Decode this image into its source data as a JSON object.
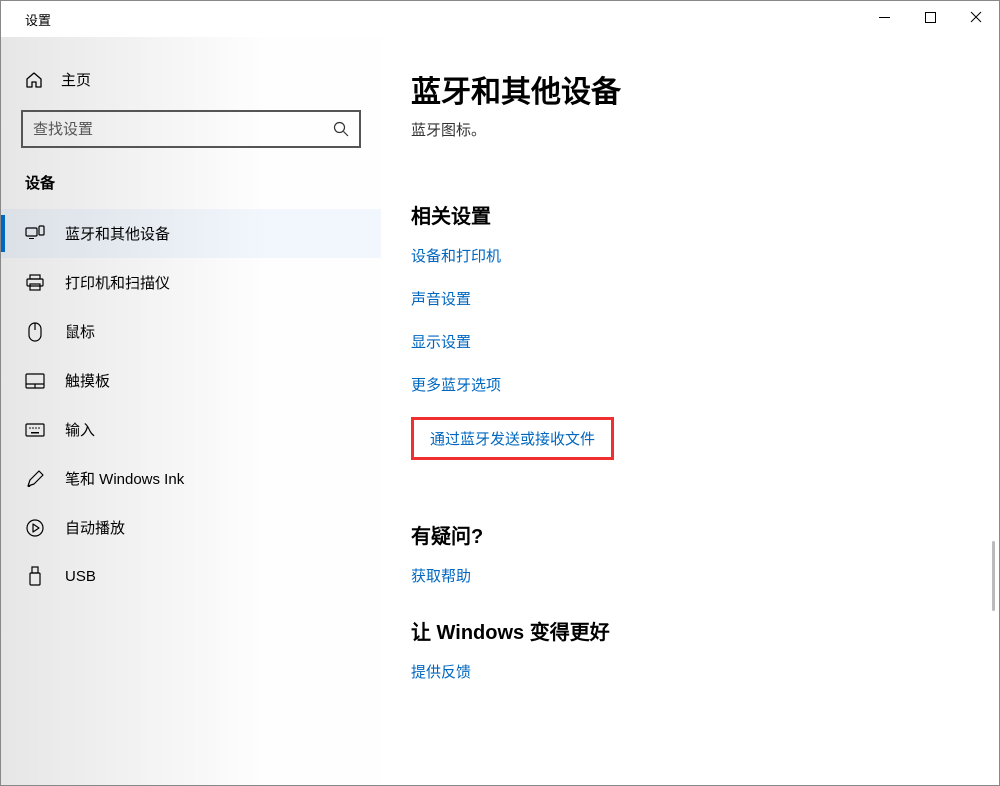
{
  "window": {
    "title": "设置"
  },
  "sidebar": {
    "home_label": "主页",
    "search_placeholder": "查找设置",
    "section_label": "设备",
    "items": [
      {
        "label": "蓝牙和其他设备",
        "selected": true
      },
      {
        "label": "打印机和扫描仪",
        "selected": false
      },
      {
        "label": "鼠标",
        "selected": false
      },
      {
        "label": "触摸板",
        "selected": false
      },
      {
        "label": "输入",
        "selected": false
      },
      {
        "label": "笔和 Windows Ink",
        "selected": false
      },
      {
        "label": "自动播放",
        "selected": false
      },
      {
        "label": "USB",
        "selected": false
      }
    ]
  },
  "content": {
    "heading": "蓝牙和其他设备",
    "subtext": "蓝牙图标。",
    "related_heading": "相关设置",
    "related_links": {
      "devices_printers": "设备和打印机",
      "sound": "声音设置",
      "display": "显示设置",
      "more_bt": "更多蓝牙选项",
      "send_receive": "通过蓝牙发送或接收文件"
    },
    "question_heading": "有疑问?",
    "get_help_link": "获取帮助",
    "improve_heading": "让 Windows 变得更好",
    "feedback_link": "提供反馈"
  }
}
